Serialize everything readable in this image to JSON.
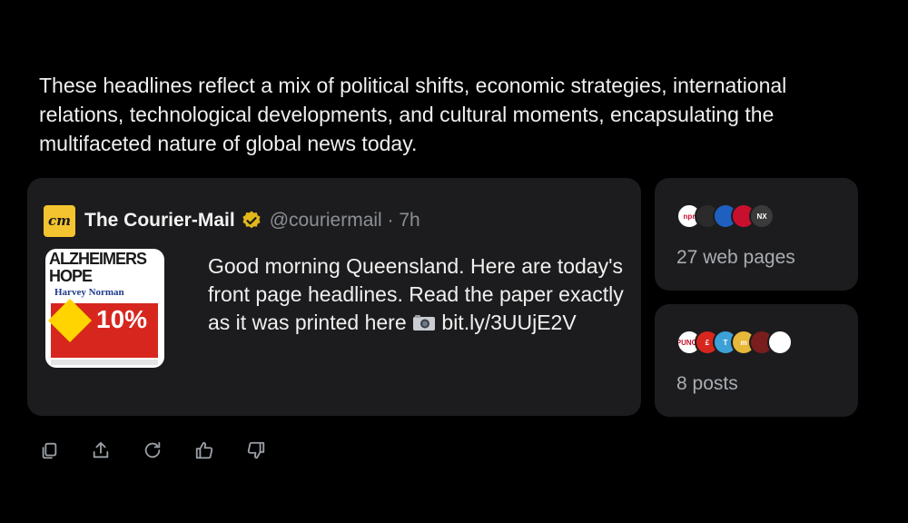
{
  "summary": "These headlines reflect a mix of political shifts, economic strategies, international relations, technological developments, and cultural moments, encapsulating the multifaceted nature of global news today.",
  "tweet": {
    "avatar_text": "cm",
    "display_name": "The Courier-Mail",
    "handle_time": "@couriermail · 7h",
    "text": "Good morning Queensland. Here are today's front page headlines. Read the paper exactly as it was printed here",
    "link": "bit.ly/3UUjE2V",
    "thumbnail": {
      "headline1": "ALZHEIMERS",
      "headline2": "HOPE",
      "advertiser": "Harvey Norman",
      "offer": "10%"
    }
  },
  "sources": {
    "web_pages_label": "27 web pages",
    "web_logos": [
      {
        "icon": "npr-logo",
        "text": "npr",
        "color": "#ffffff"
      },
      {
        "icon": "news-logo",
        "text": "",
        "color": "#2b2b2b"
      },
      {
        "icon": "abc-logo",
        "text": "",
        "color": "#1f5fbf"
      },
      {
        "icon": "cnn-logo",
        "text": "",
        "color": "#c8102e"
      },
      {
        "icon": "nx-logo",
        "text": "NX",
        "color": "#3a3a3a"
      }
    ],
    "posts_label": "8 posts",
    "post_logos": [
      {
        "icon": "punch-logo",
        "text": "PUNCH",
        "color": "#ffffff"
      },
      {
        "icon": "pound-logo",
        "text": "£",
        "color": "#d7261e"
      },
      {
        "icon": "t-logo",
        "text": "T",
        "color": "#3da1d8"
      },
      {
        "icon": "m-logo",
        "text": "m",
        "color": "#e8b83a"
      },
      {
        "icon": "news-seal-logo",
        "text": "",
        "color": "#7a1d1d"
      },
      {
        "icon": "white-logo",
        "text": "",
        "color": "#ffffff"
      }
    ]
  },
  "actions": [
    {
      "icon": "copy-icon"
    },
    {
      "icon": "share-icon"
    },
    {
      "icon": "regenerate-icon"
    },
    {
      "icon": "thumbs-up-icon"
    },
    {
      "icon": "thumbs-down-icon"
    }
  ],
  "colors": {
    "background": "#000000",
    "card": "#1c1c1e",
    "verified_gold": "#e2b719"
  }
}
